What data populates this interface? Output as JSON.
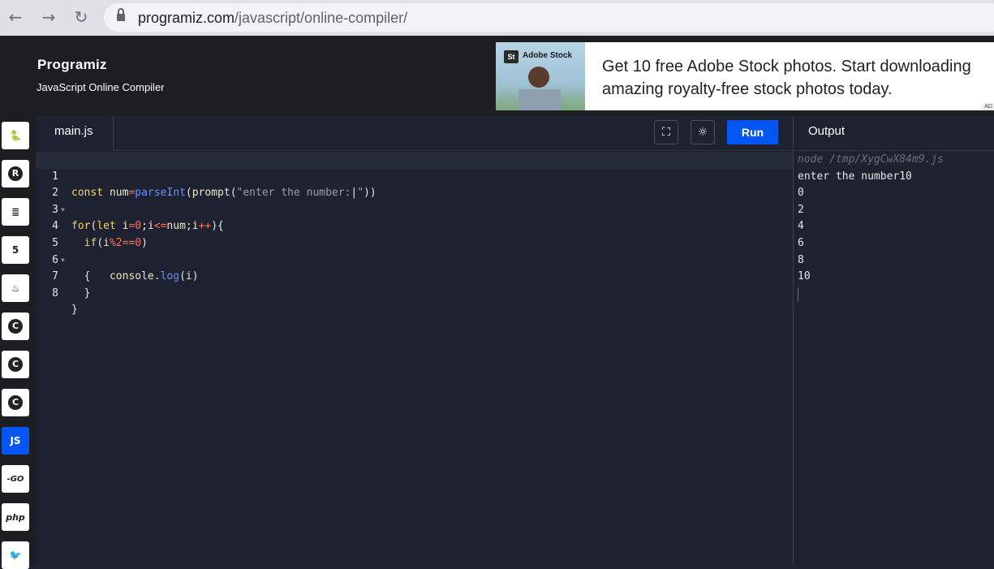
{
  "browser": {
    "url_host": "programiz.com",
    "url_path": "/javascript/online-compiler/",
    "back_icon": "←",
    "forward_icon": "→",
    "reload_icon": "↻"
  },
  "header": {
    "logo": "Programiz",
    "subtitle": "JavaScript Online Compiler"
  },
  "ad": {
    "brand_badge": "St",
    "brand_name": "Adobe Stock",
    "text": "Get 10 free Adobe Stock photos. Start downloading amazing royalty-free stock photos today.",
    "tag": "AD"
  },
  "sidebar": {
    "items": [
      {
        "name": "python",
        "label": "🐍"
      },
      {
        "name": "r",
        "label": "R"
      },
      {
        "name": "sql",
        "label": "≣"
      },
      {
        "name": "html",
        "label": "5"
      },
      {
        "name": "java",
        "label": "♨"
      },
      {
        "name": "c",
        "label": "C"
      },
      {
        "name": "cpp",
        "label": "C"
      },
      {
        "name": "csharp",
        "label": "C"
      },
      {
        "name": "js",
        "label": "JS"
      },
      {
        "name": "go",
        "label": "-GO"
      },
      {
        "name": "php",
        "label": "php"
      },
      {
        "name": "swift",
        "label": "🐦"
      }
    ],
    "active": "js"
  },
  "editor": {
    "tab": "main.js",
    "fullscreen_icon": "⛶",
    "theme_icon": "☼",
    "run_label": "Run",
    "line_numbers": [
      "1",
      "2",
      "3",
      "4",
      "5",
      "6",
      "7",
      "8"
    ]
  },
  "output": {
    "title": "Output",
    "command": "node /tmp/XygCwX84m9.js",
    "lines": [
      "enter the number10",
      "0",
      "2",
      "4",
      "6",
      "8",
      "10"
    ]
  }
}
